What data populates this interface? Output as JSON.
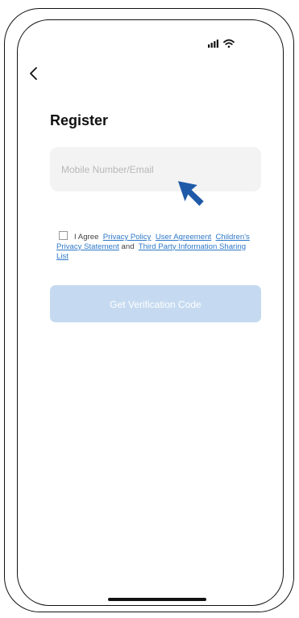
{
  "screen": {
    "title": "Register"
  },
  "form": {
    "identifier_placeholder": "Mobile Number/Email",
    "identifier_value": ""
  },
  "agreement": {
    "checked": false,
    "prefix": "I Agree",
    "privacy_policy": "Privacy Policy",
    "user_agreement": "User Agreement",
    "children_privacy": "Children's Privacy Statement",
    "and": "and",
    "third_party": "Third Party Information Sharing List"
  },
  "actions": {
    "get_code_label": "Get Verification Code"
  },
  "colors": {
    "link": "#2e78c8",
    "button_disabled": "#c5daf0",
    "input_bg": "#f3f3f3",
    "cursor": "#1f5aa8"
  },
  "icons": {
    "back": "chevron-left-icon",
    "signal": "signal-icon",
    "wifi": "wifi-icon",
    "pointer": "mouse-cursor-icon"
  }
}
